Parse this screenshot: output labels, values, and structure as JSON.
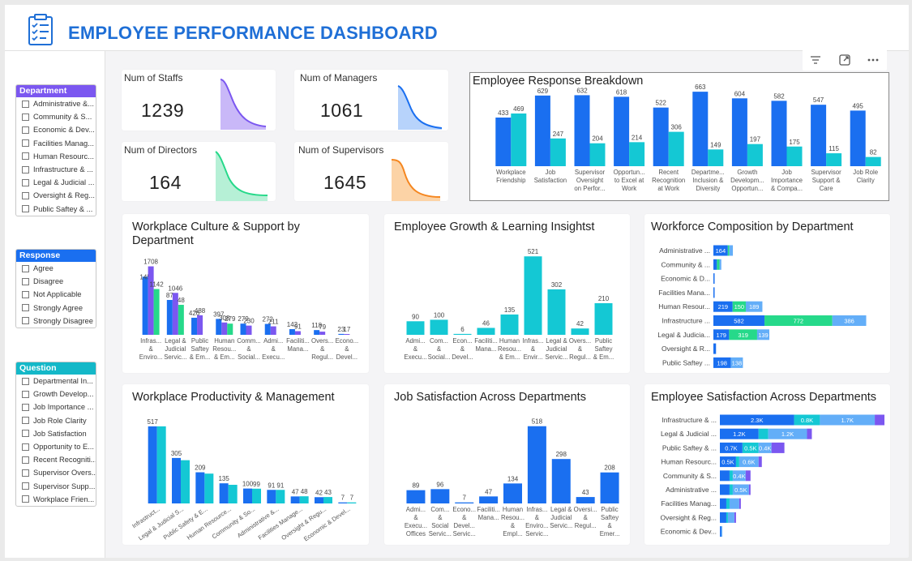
{
  "header": {
    "title": "EMPLOYEE PERFORMANCE DASHBOARD"
  },
  "colors": {
    "blue": "#1a6ff0",
    "teal": "#14c8d4",
    "purple": "#7b57f0",
    "green": "#26d98a",
    "lightblue": "#63aef8",
    "title": "#1f6fd6"
  },
  "slicers": {
    "department": {
      "title": "Department",
      "color": "#7b57f0",
      "items": [
        "Administrative &...",
        "Community & S...",
        "Economic & Dev...",
        "Facilities Manag...",
        "Human Resourc...",
        "Infrastructure & ...",
        "Legal & Judicial ...",
        "Oversight & Reg...",
        "Public Saftey & ..."
      ]
    },
    "response": {
      "title": "Response",
      "color": "#1a6ff0",
      "items": [
        "Agree",
        "Disagree",
        "Not Applicable",
        "Strongly Agree",
        "Strongly Disagree"
      ]
    },
    "question": {
      "title": "Question",
      "color": "#14b8c8",
      "items": [
        "Departmental In...",
        "Growth Develop...",
        "Job Importance ...",
        "Job Role Clarity",
        "Job Satisfaction",
        "Opportunity to E...",
        "Recent Recogniti...",
        "Supervisor Overs...",
        "Supervisor Supp...",
        "Workplace Frien..."
      ]
    }
  },
  "kpis": [
    {
      "label": "Num of Staffs",
      "value": "1239",
      "color": "#8d6ff0"
    },
    {
      "label": "Num of Managers",
      "value": "1061",
      "color": "#3f8ff5"
    },
    {
      "label": "Num of Directors",
      "value": "164",
      "color": "#38d49a"
    },
    {
      "label": "Num of Supervisors",
      "value": "1645",
      "color": "#f59a2c"
    }
  ],
  "charts": {
    "response_breakdown": {
      "title": "Employee Response Breakdown",
      "chart_data": {
        "type": "bar",
        "categories": [
          [
            "Workplace",
            "Friendship"
          ],
          [
            "Job",
            "Satisfaction"
          ],
          [
            "Supervisor",
            "Oversight",
            "on Perfor..."
          ],
          [
            "Opportun...",
            "to Excel at",
            "Work"
          ],
          [
            "Recent",
            "Recognition",
            "at Work"
          ],
          [
            "Departme...",
            "Inclusion &",
            "Diversity"
          ],
          [
            "Growth",
            "Developm...",
            "Opportun..."
          ],
          [
            "Job",
            "Importance",
            "& Compa..."
          ],
          [
            "Supervisor",
            "Support &",
            "Care"
          ],
          [
            "Job Role",
            "Clarity"
          ]
        ],
        "series": [
          {
            "values": [
              433,
              629,
              632,
              618,
              522,
              663,
              604,
              582,
              547,
              495
            ]
          },
          {
            "values": [
              469,
              247,
              204,
              214,
              306,
              149,
              197,
              175,
              115,
              82
            ]
          }
        ],
        "ylim": [
          0,
          700
        ]
      }
    },
    "culture": {
      "title": "Workplace Culture & Support by Department",
      "chart_data": {
        "type": "bar",
        "categories": [
          [
            "Infras...",
            "&",
            "Enviro..."
          ],
          [
            "Legal &",
            "Judicial",
            "Servic..."
          ],
          [
            "Public",
            "Saftey",
            "& Em..."
          ],
          [
            "Human",
            "Resou...",
            "& Em..."
          ],
          [
            "Comm...",
            "&",
            "Social..."
          ],
          [
            "Admi...",
            "&",
            "Execu..."
          ],
          [
            "Faciliti...",
            "Mana..."
          ],
          [
            "Overs...",
            "&",
            "Regul..."
          ],
          [
            "Econo...",
            "&",
            "Devel..."
          ]
        ],
        "series": [
          {
            "values": [
              1450,
              870,
              426,
              397,
              279,
              272,
              142,
              118,
              23
            ]
          },
          {
            "values": [
              1708,
              1046,
              488,
              308,
              230,
              211,
              91,
              79,
              17
            ]
          },
          {
            "values": [
              1142,
              748,
              0,
              279,
              0,
              0,
              0,
              0,
              0
            ]
          }
        ],
        "labels": [
          [
            "145",
            "1708",
            "1142"
          ],
          [
            "87",
            "1046",
            "48"
          ],
          [
            "426",
            "488",
            ""
          ],
          [
            "397",
            "308",
            "279"
          ],
          [
            "279",
            "230",
            ""
          ],
          [
            "272",
            "211",
            ""
          ],
          [
            "142",
            "91",
            ""
          ],
          [
            "118",
            "79",
            ""
          ],
          [
            "23",
            "17",
            ""
          ]
        ],
        "ylim": [
          0,
          1800
        ]
      }
    },
    "growth": {
      "title": "Employee Growth & Learning Insightst",
      "chart_data": {
        "type": "bar",
        "categories": [
          [
            "Admi...",
            "&",
            "Execu..."
          ],
          [
            "Com...",
            "&",
            "Social..."
          ],
          [
            "Econ...",
            "&",
            "Devel..."
          ],
          [
            "Faciliti...",
            "Mana..."
          ],
          [
            "Human",
            "Resou...",
            "& Em..."
          ],
          [
            "Infras...",
            "&",
            "Envir..."
          ],
          [
            "Legal &",
            "Judicial",
            "Servic..."
          ],
          [
            "Overs...",
            "&",
            "Regul..."
          ],
          [
            "Public",
            "Saftey",
            "& Em..."
          ]
        ],
        "values": [
          90,
          100,
          6,
          46,
          135,
          521,
          302,
          42,
          210
        ],
        "ylim": [
          0,
          560
        ]
      }
    },
    "workforce": {
      "title": "Workforce Composition by Department",
      "chart_data": {
        "type": "bar",
        "orientation": "horizontal-stacked",
        "categories": [
          "Administrative ...",
          "Community & ...",
          "Economic & D...",
          "Facilities Mana...",
          "Human Resour...",
          "Infrastructure ...",
          "Legal & Judicia...",
          "Oversight & R...",
          "Public Saftey ..."
        ],
        "series": [
          {
            "values": [
              164,
              40,
              8,
              10,
              219,
              582,
              179,
              30,
              198
            ]
          },
          {
            "values": [
              18,
              30,
              0,
              0,
              150,
              772,
              319,
              0,
              0
            ]
          },
          {
            "values": [
              40,
              20,
              0,
              0,
              189,
              386,
              139,
              0,
              138
            ]
          }
        ],
        "labels": [
          [
            "164",
            "",
            ""
          ],
          [
            "",
            "",
            ""
          ],
          [
            "",
            "",
            ""
          ],
          [
            "",
            "",
            ""
          ],
          [
            "219",
            "150",
            "189"
          ],
          [
            "582",
            "772",
            "386"
          ],
          [
            "179",
            "319",
            "139"
          ],
          [
            "",
            "",
            ""
          ],
          [
            "198",
            "",
            "138"
          ]
        ],
        "xlim": [
          0,
          1800
        ]
      }
    },
    "productivity": {
      "title": "Workplace Productivity & Management",
      "chart_data": {
        "type": "bar",
        "categories": [
          "Infrastruct...",
          "Legal & Judicial S...",
          "Public Safety & E...",
          "Human Resource...",
          "Community & So...",
          "Administrative &...",
          "Facilities Manage...",
          "Oversight & Regu...",
          "Economic & Devel..."
        ],
        "series": [
          {
            "values": [
              517,
              305,
              209,
              135,
              100,
              91,
              47,
              42,
              7
            ]
          },
          {
            "values": [
              517,
              290,
              200,
              125,
              99,
              91,
              48,
              43,
              7
            ]
          }
        ],
        "labels": [
          [
            "517",
            ""
          ],
          [
            "305",
            ""
          ],
          [
            "209",
            ""
          ],
          [
            "135",
            ""
          ],
          [
            "100",
            "99"
          ],
          [
            "91",
            "91"
          ],
          [
            "47",
            "48"
          ],
          [
            "42",
            "43"
          ],
          [
            "7",
            "7"
          ]
        ],
        "ylim": [
          0,
          560
        ]
      }
    },
    "satisfaction": {
      "title": "Job Satisfaction Across Departments",
      "chart_data": {
        "type": "bar",
        "categories": [
          [
            "Admi...",
            "&",
            "Execu...",
            "Offices"
          ],
          [
            "Com...",
            "&",
            "Social",
            "Servic..."
          ],
          [
            "Econo...",
            "&",
            "Devel...",
            "Servic..."
          ],
          [
            "Faciliti...",
            "Mana..."
          ],
          [
            "Human",
            "Resou...",
            "&",
            "Empl..."
          ],
          [
            "Infras...",
            "&",
            "Enviro...",
            "Servic..."
          ],
          [
            "Legal &",
            "Judicial",
            "Servic..."
          ],
          [
            "Oversi...",
            "&",
            "Regul..."
          ],
          [
            "Public",
            "Saftey",
            "&",
            "Emer..."
          ]
        ],
        "values": [
          89,
          96,
          7,
          47,
          134,
          518,
          298,
          43,
          208
        ],
        "ylim": [
          0,
          560
        ]
      }
    },
    "emp_satisfaction": {
      "title": "Employee Satisfaction Across Departments",
      "chart_data": {
        "type": "bar",
        "orientation": "horizontal-stacked",
        "categories": [
          "Infrastructure & ...",
          "Legal & Judicial ...",
          "Public Saftey & ...",
          "Human Resourc...",
          "Community & S...",
          "Administrative ...",
          "Facilities Manag...",
          "Oversight & Reg...",
          "Economic & Dev..."
        ],
        "series": [
          {
            "values": [
              2.3,
              1.2,
              0.7,
              0.5,
              0.3,
              0.3,
              0.2,
              0.2,
              0.02
            ]
          },
          {
            "values": [
              0.8,
              0.3,
              0.5,
              0.1,
              0.1,
              0.1,
              0.1,
              0.05,
              0.0
            ]
          },
          {
            "values": [
              1.7,
              1.2,
              0.4,
              0.6,
              0.4,
              0.5,
              0.3,
              0.2,
              0.03
            ]
          },
          {
            "values": [
              0.3,
              0.15,
              0.4,
              0.1,
              0.15,
              0.05,
              0.05,
              0.05,
              0.0
            ]
          }
        ],
        "labels": [
          [
            "2.3K",
            "0.8K",
            "1.7K",
            ""
          ],
          [
            "1.2K",
            "",
            "1.2K",
            ""
          ],
          [
            "0.7K",
            "0.5K",
            "0.4K",
            ""
          ],
          [
            "0.5K",
            "",
            "0.6K",
            ""
          ],
          [
            "",
            "",
            "0.4K",
            ""
          ],
          [
            "",
            "",
            "0.5K",
            ""
          ],
          [
            "",
            "",
            "",
            ""
          ],
          [
            "",
            "",
            "",
            ""
          ],
          [
            "",
            "",
            "",
            ""
          ]
        ],
        "xlim": [
          0,
          5.2
        ]
      }
    }
  }
}
